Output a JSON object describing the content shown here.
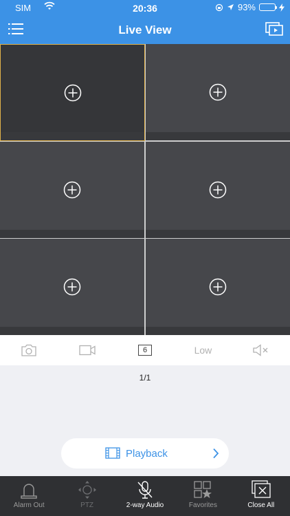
{
  "status_bar": {
    "carrier": "SIM",
    "time": "20:36",
    "battery": "93%",
    "battery_level": 0.93
  },
  "nav": {
    "title": "Live View"
  },
  "grid": {
    "split_count": "6",
    "cells": [
      {
        "selected": true
      },
      {
        "selected": false
      },
      {
        "selected": false
      },
      {
        "selected": false
      },
      {
        "selected": false
      },
      {
        "selected": false
      }
    ]
  },
  "toolbar": {
    "quality_label": "Low",
    "split_label": "6"
  },
  "page_indicator": "1/1",
  "playback": {
    "label": "Playback"
  },
  "tabbar": {
    "items": [
      {
        "label": "Alarm Out",
        "icon": "alarm-light-icon"
      },
      {
        "label": "PTZ",
        "icon": "ptz-icon"
      },
      {
        "label": "2-way Audio",
        "icon": "mic-muted-icon"
      },
      {
        "label": "Favorites",
        "icon": "favorites-icon"
      },
      {
        "label": "Close All",
        "icon": "close-all-icon"
      }
    ]
  },
  "colors": {
    "header": "#3c92e6",
    "cell": "#46474b",
    "selected_border": "#e0b24a",
    "tabbar": "#2f3033"
  }
}
